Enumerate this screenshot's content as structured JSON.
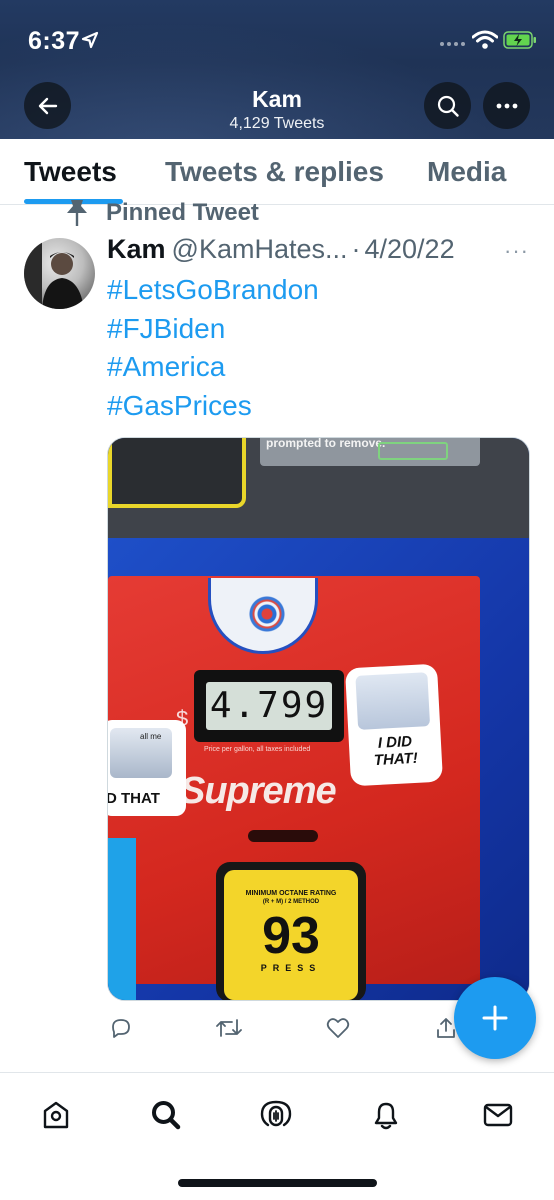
{
  "status_bar": {
    "time": "6:37"
  },
  "header": {
    "name": "Kam",
    "tweet_count": "4,129 Tweets"
  },
  "tabs": [
    {
      "label": "Tweets",
      "selected": true
    },
    {
      "label": "Tweets & replies",
      "selected": false
    },
    {
      "label": "Media",
      "selected": false
    }
  ],
  "tweet": {
    "pinned_label": "Pinned Tweet",
    "name": "Kam",
    "handle": "@KamHates...",
    "separator": "·",
    "date": "4/20/22",
    "more": "···",
    "hashtags": [
      "#LetsGoBrandon",
      "#FJBiden",
      "#America",
      "#GasPrices"
    ],
    "media": {
      "label_text": "prompted to remove.",
      "price_display": "4.799",
      "price_unit": "$",
      "fine_print": "Price per gallon, all taxes included",
      "brand_sticker": "Supreme",
      "sticker_right": "I DID THAT!",
      "sticker_left_small": "all me",
      "sticker_left": "D THAT",
      "octane_title": "MINIMUM OCTANE RATING",
      "octane_method": "(R + M) / 2 METHOD",
      "octane_value": "93",
      "octane_press": "PRESS"
    }
  },
  "colors": {
    "accent": "#1d9bf0",
    "header_bg": "#22375e",
    "text_primary": "#0f1419",
    "text_secondary": "#536471"
  },
  "icons": {
    "back": "arrow-left-icon",
    "search": "search-icon",
    "more": "more-horizontal-icon",
    "compose": "plus-icon",
    "nav": [
      "home-icon",
      "search-icon",
      "spaces-icon",
      "bell-icon",
      "mail-icon"
    ]
  }
}
